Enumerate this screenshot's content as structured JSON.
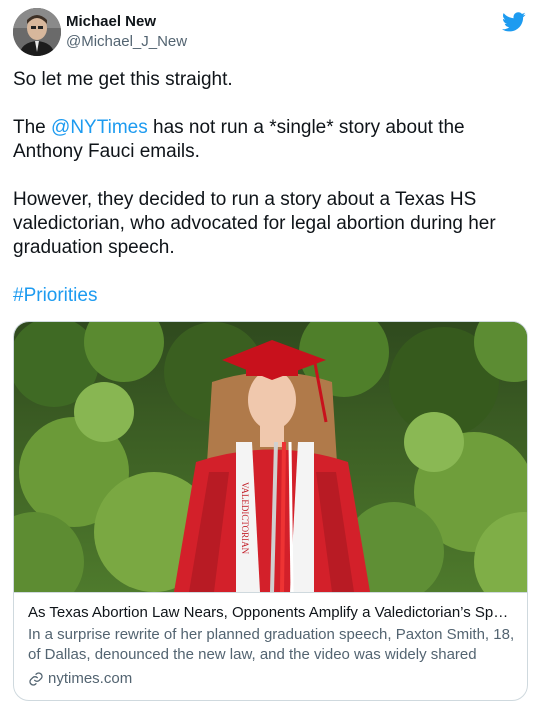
{
  "author": {
    "display_name": "Michael New",
    "handle": "@Michael_J_New"
  },
  "tweet": {
    "line1": "So let me get this straight.",
    "p2_prefix": "The ",
    "p2_mention": "@NYTimes",
    "p2_suffix": " has not run a *single* story about the Anthony Fauci emails.",
    "p3": "However, they decided to run a story about a Texas HS valedictorian, who advocated for legal abortion during her graduation speech.",
    "hashtag": "#Priorities"
  },
  "card": {
    "title": "As Texas Abortion Law Nears, Opponents Amplify a Valedictorian’s Spee...",
    "description": "In a surprise rewrite of her planned graduation speech, Paxton Smith, 18, of Dallas, denounced the new law, and the video was widely shared",
    "domain": "nytimes.com",
    "stole_text": "VALEDICTORIAN"
  },
  "icons": {
    "brand": "twitter-bird-icon",
    "link": "link-icon"
  },
  "colors": {
    "link_blue": "#1d9bf0",
    "text": "#0f1419",
    "secondary": "#536471",
    "border": "#cfd9de"
  }
}
